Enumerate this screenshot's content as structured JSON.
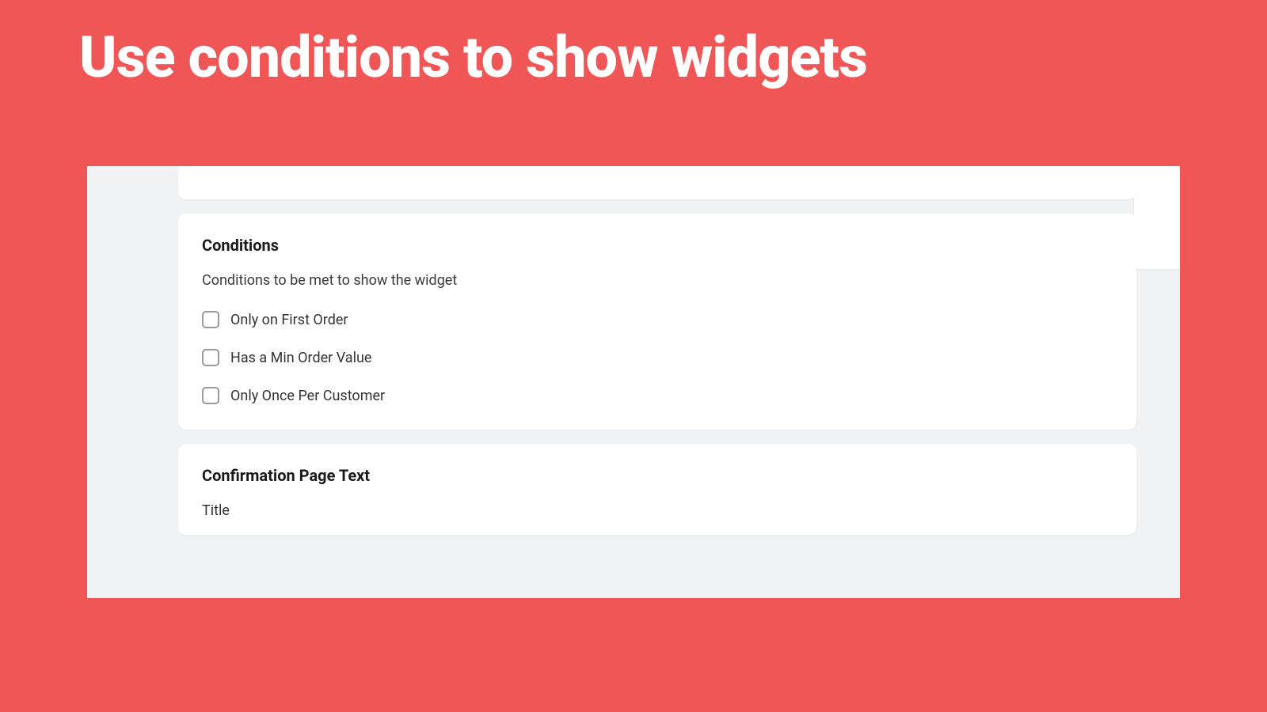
{
  "headline": "Use conditions to show widgets",
  "conditions": {
    "heading": "Conditions",
    "subtext": "Conditions to be met to show the widget",
    "options": [
      "Only on First Order",
      "Has a Min Order Value",
      "Only Once Per Customer"
    ]
  },
  "confirmation": {
    "heading": "Confirmation Page Text",
    "field_label": "Title"
  }
}
